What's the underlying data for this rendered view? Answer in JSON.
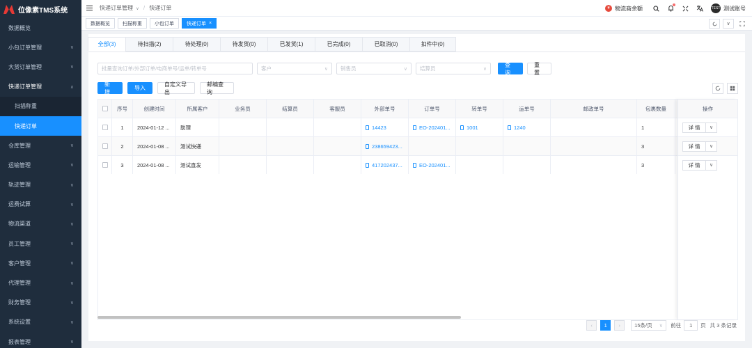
{
  "app": {
    "title": "位像素TMS系统"
  },
  "sidebar": {
    "items": [
      {
        "label": "数据概览",
        "chevron": false
      },
      {
        "label": "小包订单管理",
        "chevron": true
      },
      {
        "label": "大货订单管理",
        "chevron": true
      },
      {
        "label": "快递订单管理",
        "chevron": true,
        "open": true
      },
      {
        "label": "扫描称重",
        "sub": true
      },
      {
        "label": "快递订单",
        "sub": true,
        "active": true
      },
      {
        "label": "仓库管理",
        "chevron": true
      },
      {
        "label": "运输管理",
        "chevron": true
      },
      {
        "label": "轨迹管理",
        "chevron": true
      },
      {
        "label": "运费试算",
        "chevron": true
      },
      {
        "label": "物流渠道",
        "chevron": true
      },
      {
        "label": "员工管理",
        "chevron": true
      },
      {
        "label": "客户管理",
        "chevron": true
      },
      {
        "label": "代理管理",
        "chevron": true
      },
      {
        "label": "财务管理",
        "chevron": true
      },
      {
        "label": "系统设置",
        "chevron": true
      },
      {
        "label": "报表管理",
        "chevron": true
      }
    ]
  },
  "breadcrumb": {
    "parent": "快递订单管理",
    "sep": "/",
    "current": "快递订单"
  },
  "header": {
    "balance_label": "物流商余额",
    "balance_icon": "¥",
    "avatar_text": "TEST",
    "user": "测试账号"
  },
  "tagsview": {
    "tags": [
      {
        "label": "数据概览"
      },
      {
        "label": "扫描称重"
      },
      {
        "label": "小包订单"
      },
      {
        "label": "快递订单",
        "active": true
      }
    ],
    "close": "×"
  },
  "tabs": [
    {
      "label": "全部(3)",
      "active": true
    },
    {
      "label": "待扫描(2)"
    },
    {
      "label": "待处理(0)"
    },
    {
      "label": "待发货(0)"
    },
    {
      "label": "已发货(1)"
    },
    {
      "label": "已完成(0)"
    },
    {
      "label": "已取消(0)"
    },
    {
      "label": "扣件中(0)"
    }
  ],
  "filters": {
    "batch_placeholder": "批量查询订单/外部订单/电商单号/运单/转单号",
    "customer_placeholder": "客户",
    "sales_placeholder": "销售员",
    "settler_placeholder": "结算员",
    "search_label": "查 询",
    "reset_label": "重 置"
  },
  "actions": {
    "new_label": "新 增",
    "import_label": "导入",
    "export_label": "自定义导出",
    "postal_label": "邮编查询"
  },
  "table": {
    "headers": [
      "序号",
      "创建时间",
      "所属客户",
      "业务员",
      "结算员",
      "客服员",
      "外部单号",
      "订单号",
      "转单号",
      "运单号",
      "邮政单号",
      "包裹数量"
    ],
    "op_header": "操作",
    "op_label": "详 情",
    "rows": [
      {
        "no": "1",
        "time": "2024-01-12 ...",
        "customer": "助理",
        "sales": "",
        "settler": "",
        "service": "",
        "external": "14423",
        "order": "EO-202401...",
        "transfer": "1001",
        "waybill": "1240",
        "postal": "",
        "qty": "1"
      },
      {
        "no": "2",
        "time": "2024-01-08 ...",
        "customer": "测试快递",
        "sales": "",
        "settler": "",
        "service": "",
        "external": "238659423...",
        "order": "",
        "transfer": "",
        "waybill": "",
        "postal": "",
        "qty": "3"
      },
      {
        "no": "3",
        "time": "2024-01-08 ...",
        "customer": "测试直发",
        "sales": "",
        "settler": "",
        "service": "",
        "external": "417202437...",
        "order": "EO-202401...",
        "transfer": "",
        "waybill": "",
        "postal": "",
        "qty": "3"
      }
    ]
  },
  "pagination": {
    "current": "1",
    "page_size": "15条/页",
    "goto_label": "前往",
    "goto_value": "1",
    "page_unit": "页",
    "total": "共 3 条记录"
  },
  "colors": {
    "sidebar_bg": "#1f2d3d",
    "accent": "#1890ff",
    "active_tab": "#1890ff"
  }
}
